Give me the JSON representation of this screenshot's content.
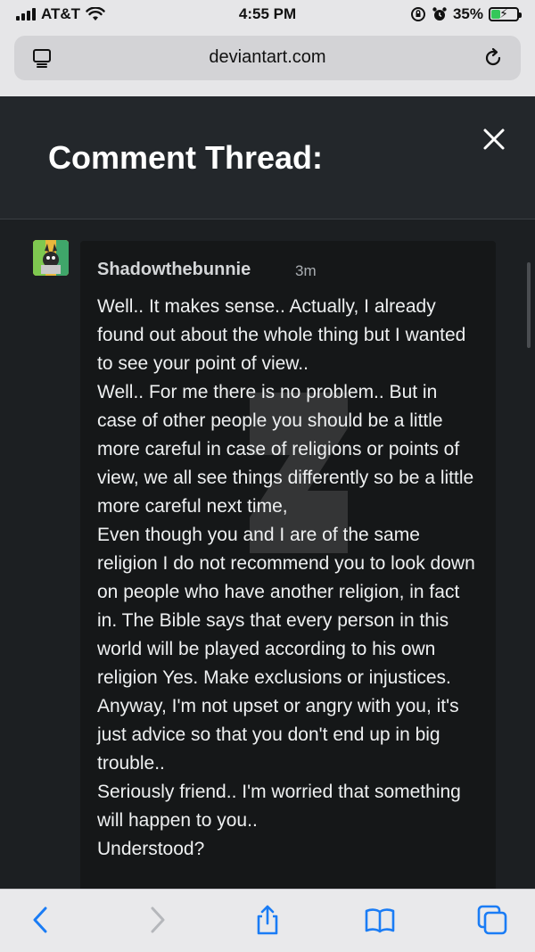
{
  "status_bar": {
    "carrier": "AT&T",
    "time": "4:55 PM",
    "battery_percent": "35%",
    "battery_level": 0.35
  },
  "browser": {
    "url": "deviantart.com"
  },
  "panel": {
    "title": "Comment Thread:"
  },
  "comment": {
    "author": "Shadowthebunnie",
    "time": "3m",
    "lines": [
      "Well.. It makes sense.. Actually, I already found out about the whole thing but I wanted to see your point of view..",
      "Well.. For me there is no problem.. But in case of other people you should be a little more careful in case of religions or points of view, we all see things differently so be a little more careful next time,",
      "Even though you and I are of the same religion I do not recommend you to look down on people who have another religion, in fact in. The Bible says that every person in this world will be played according to his own religion Yes. Make exclusions or injustices.",
      "Anyway, I'm not upset or angry with you, it's just advice so that you don't end up in big trouble..",
      "Seriously friend.. I'm worried that something will happen to you..",
      "Understood?"
    ]
  },
  "icons": {
    "reader": "reader-icon",
    "reload": "reload-icon",
    "close": "close-icon",
    "back": "back-chevron-icon",
    "forward": "forward-chevron-icon",
    "share": "share-icon",
    "bookmarks": "book-icon",
    "tabs": "tabs-icon"
  },
  "colors": {
    "accent": "#1a7cf5",
    "battery": "#34c759",
    "panel_bg": "#1c1f22",
    "card_bg": "#151718"
  }
}
